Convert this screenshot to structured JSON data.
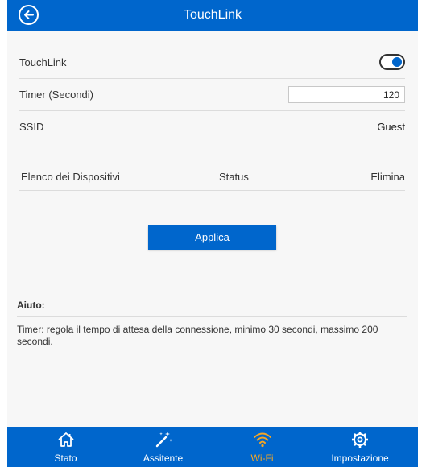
{
  "header": {
    "title": "TouchLink",
    "back_icon": "back-arrow-circle-icon"
  },
  "settings": {
    "touchlink": {
      "label": "TouchLink",
      "enabled": true
    },
    "timer": {
      "label": "Timer (Secondi)",
      "value": "120"
    },
    "ssid": {
      "label": "SSID",
      "value": "Guest"
    }
  },
  "devices": {
    "columns": [
      "Elenco dei Dispositivi",
      "Status",
      "Elimina"
    ],
    "rows": []
  },
  "apply_label": "Applica",
  "help": {
    "title": "Aiuto:",
    "text": "Timer: regola il tempo di attesa della connessione, minimo 30 secondi, massimo 200 secondi."
  },
  "nav": {
    "items": [
      {
        "label": "Stato",
        "icon": "home-icon"
      },
      {
        "label": "Assitente",
        "icon": "magic-wand-icon"
      },
      {
        "label": "Wi-Fi",
        "icon": "wifi-icon",
        "active": true
      },
      {
        "label": "Impostazione",
        "icon": "gear-icon"
      }
    ]
  },
  "colors": {
    "primary": "#0066cc",
    "active_nav": "#f5a623",
    "background": "#f7f7f7"
  }
}
